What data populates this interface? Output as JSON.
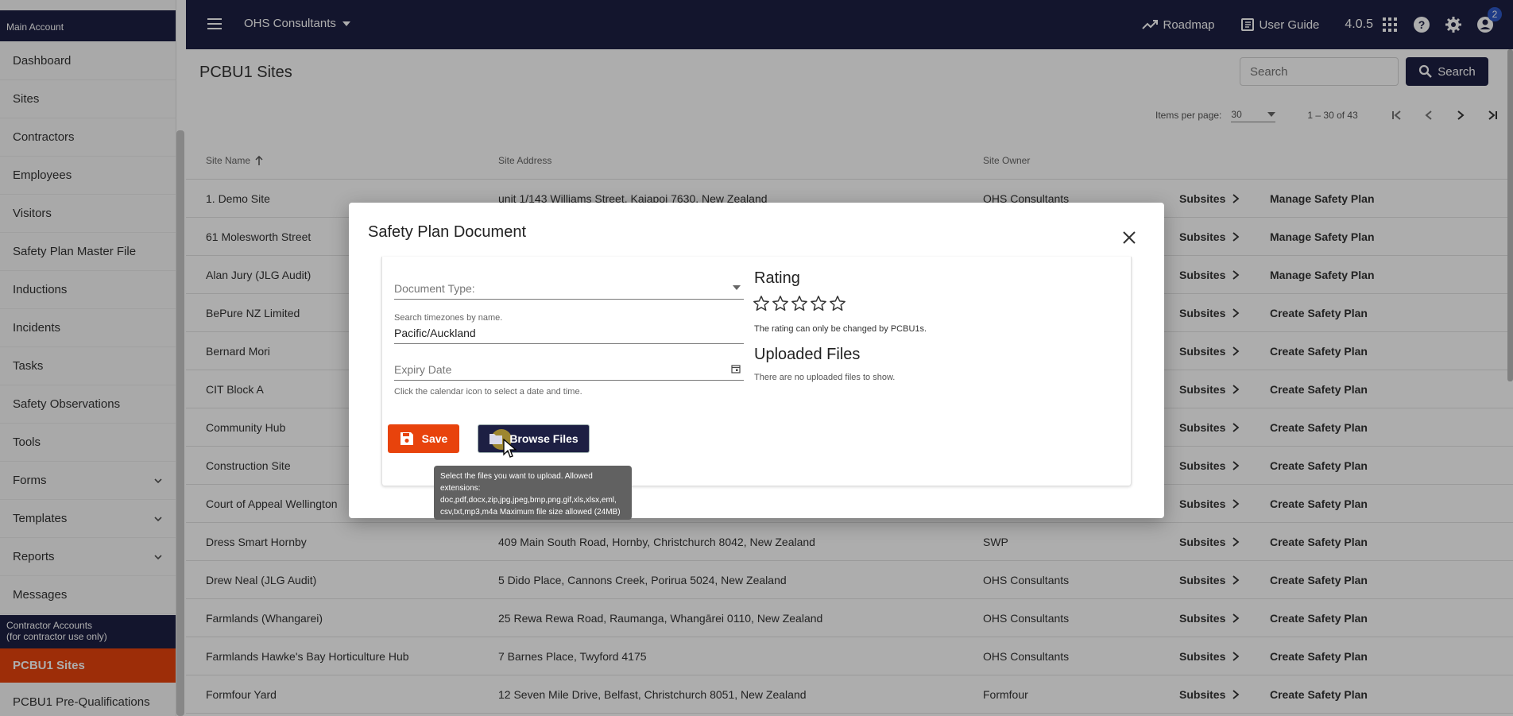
{
  "sidebar": {
    "header": "Main Account",
    "items": [
      {
        "label": "Dashboard",
        "expandable": false
      },
      {
        "label": "Sites",
        "expandable": false
      },
      {
        "label": "Contractors",
        "expandable": false
      },
      {
        "label": "Employees",
        "expandable": false
      },
      {
        "label": "Visitors",
        "expandable": false
      },
      {
        "label": "Safety Plan Master File",
        "expandable": false
      },
      {
        "label": "Inductions",
        "expandable": false
      },
      {
        "label": "Incidents",
        "expandable": false
      },
      {
        "label": "Tasks",
        "expandable": false
      },
      {
        "label": "Safety Observations",
        "expandable": false
      },
      {
        "label": "Tools",
        "expandable": false
      },
      {
        "label": "Forms",
        "expandable": true
      },
      {
        "label": "Templates",
        "expandable": true
      },
      {
        "label": "Reports",
        "expandable": true
      },
      {
        "label": "Messages",
        "expandable": false
      }
    ],
    "section_line1": "Contractor Accounts",
    "section_line2": "(for contractor use only)",
    "active_item": "PCBU1 Sites",
    "after_item": "PCBU1 Pre-Qualifications"
  },
  "topbar": {
    "org": "OHS Consultants",
    "roadmap": "Roadmap",
    "user_guide": "User Guide",
    "version": "4.0.5",
    "notifications": "2"
  },
  "page": {
    "title": "PCBU1 Sites",
    "search_placeholder": "Search",
    "search_button": "Search",
    "items_per_page_label": "Items per page:",
    "items_per_page": "30",
    "range": "1 – 30 of 43"
  },
  "table": {
    "headers": {
      "name": "Site Name",
      "address": "Site Address",
      "owner": "Site Owner"
    },
    "subsites_label": "Subsites",
    "rows": [
      {
        "name": "1. Demo Site",
        "address": "unit 1/143 Williams Street, Kaiapoi 7630, New Zealand",
        "owner": "OHS Consultants",
        "action": "Manage Safety Plan"
      },
      {
        "name": "61 Molesworth Street",
        "address": "",
        "owner": "",
        "action": "Manage Safety Plan"
      },
      {
        "name": "Alan Jury (JLG Audit)",
        "address": "",
        "owner": "",
        "action": "Manage Safety Plan"
      },
      {
        "name": "BePure NZ Limited",
        "address": "",
        "owner": "",
        "action": "Create Safety Plan"
      },
      {
        "name": "Bernard Mori",
        "address": "",
        "owner": "",
        "action": "Create Safety Plan"
      },
      {
        "name": "CIT Block A",
        "address": "",
        "owner": "",
        "action": "Create Safety Plan"
      },
      {
        "name": "Community Hub",
        "address": "",
        "owner": "",
        "action": "Create Safety Plan"
      },
      {
        "name": "Construction Site",
        "address": "",
        "owner": "",
        "action": "Create Safety Plan"
      },
      {
        "name": "Court of Appeal Wellington",
        "address": "",
        "owner": "",
        "action": "Create Safety Plan"
      },
      {
        "name": "Dress Smart Hornby",
        "address": "409 Main South Road, Hornby, Christchurch 8042, New Zealand",
        "owner": "SWP",
        "action": "Create Safety Plan"
      },
      {
        "name": "Drew Neal (JLG Audit)",
        "address": "5 Dido Place, Cannons Creek, Porirua 5024, New Zealand",
        "owner": "OHS Consultants",
        "action": "Create Safety Plan"
      },
      {
        "name": "Farmlands (Whangarei)",
        "address": "25 Rewa Rewa Road, Raumanga, Whangārei 0110, New Zealand",
        "owner": "OHS Consultants",
        "action": "Create Safety Plan"
      },
      {
        "name": "Farmlands Hawke's Bay Horticulture Hub",
        "address": "7 Barnes Place, Twyford 4175",
        "owner": "OHS Consultants",
        "action": "Create Safety Plan"
      },
      {
        "name": "Formfour Yard",
        "address": "12 Seven Mile Drive, Belfast, Christchurch 8051, New Zealand",
        "owner": "Formfour",
        "action": "Create Safety Plan"
      }
    ]
  },
  "dialog": {
    "title": "Safety Plan Document",
    "document_type_placeholder": "Document Type:",
    "timezone_label": "Search timezones by name.",
    "timezone_value": "Pacific/Auckland",
    "expiry_placeholder": "Expiry Date",
    "expiry_hint": "Click the calendar icon to select a date and time.",
    "save_label": "Save",
    "browse_label": "Browse Files",
    "rating_title": "Rating",
    "rating_value": 0,
    "rating_max": 5,
    "rating_note": "The rating can only be changed by PCBU1s.",
    "uploaded_title": "Uploaded Files",
    "uploaded_note": "There are no uploaded files to show.",
    "tooltip": "Select the files you want to upload. Allowed extensions: doc,pdf,docx,zip,jpg,jpeg,bmp,png,gif,xls,xlsx,eml, csv,txt,mp3,m4a Maximum file size allowed (24MB)"
  },
  "colors": {
    "navy": "#1d1f43",
    "accent": "#e8430c"
  }
}
